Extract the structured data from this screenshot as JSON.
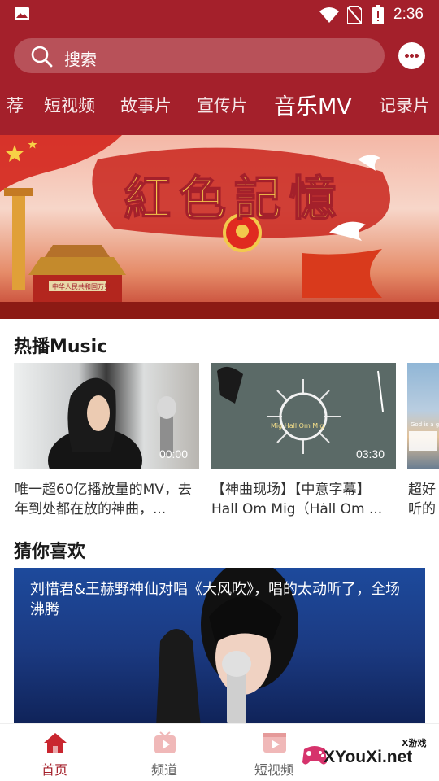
{
  "status_bar": {
    "time": "2:36"
  },
  "search": {
    "placeholder": "搜索"
  },
  "tabs": [
    {
      "label": "荐"
    },
    {
      "label": "短视频"
    },
    {
      "label": "故事片"
    },
    {
      "label": "宣传片"
    },
    {
      "label": "音乐MV",
      "active": true
    },
    {
      "label": "记录片"
    }
  ],
  "banner": {
    "title": "紅色記憶",
    "sign_text": "中华人民共和国万岁"
  },
  "hot_section": {
    "title": "热播Music",
    "cards": [
      {
        "duration": "00:00",
        "title": "唯一超60亿播放量的MV，去年到处都在放的神曲，..."
      },
      {
        "duration": "03:30",
        "title": "【神曲现场】【中意字幕】Hall Om Mig（Hȧll Om ...",
        "thumb_text": "Mig Hall Om Mig"
      },
      {
        "duration": "",
        "title": "超好听的 girl",
        "thumb_text": "God is a girl"
      }
    ]
  },
  "recommend_section": {
    "title": "猜你喜欢",
    "items": [
      {
        "caption": "刘惜君&王赫野神仙对唱《大风吹》，唱的太动听了，全场沸腾"
      }
    ]
  },
  "bottom_nav": [
    {
      "label": "首页",
      "icon": "home-icon",
      "active": true
    },
    {
      "label": "频道",
      "icon": "channel-icon"
    },
    {
      "label": "短视频",
      "icon": "video-icon"
    }
  ],
  "watermark": {
    "text": "XYouXi.net",
    "small": "X游戏"
  },
  "colors": {
    "primary": "#a4202b",
    "nav_active": "#a4202b"
  }
}
